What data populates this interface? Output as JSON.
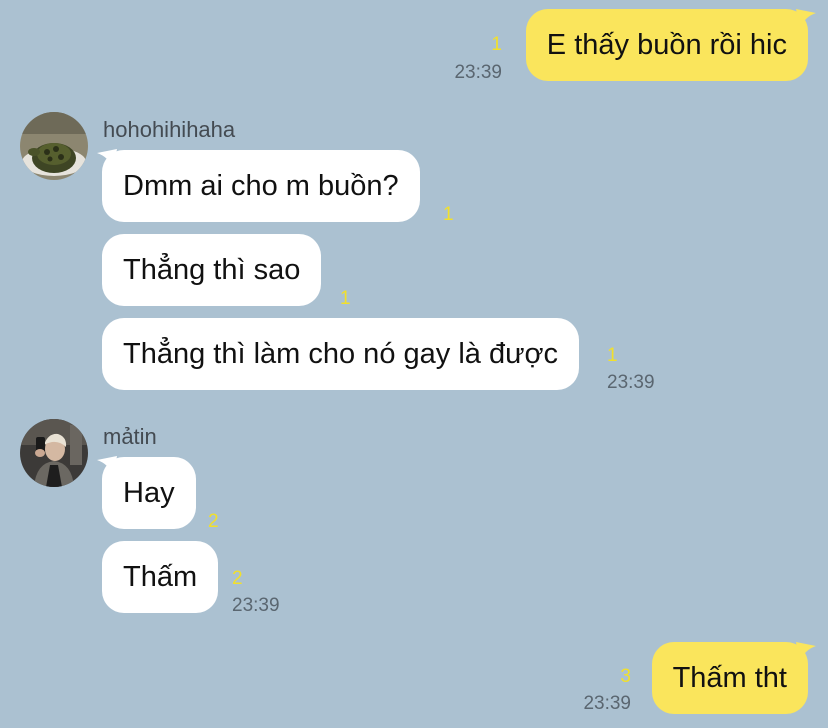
{
  "theme": {
    "background": "#abc1d1",
    "outgoing_bubble": "#fae55c",
    "incoming_bubble": "#ffffff",
    "read_count_color": "#f2e02b",
    "time_color": "#5a6670"
  },
  "messages": [
    {
      "direction": "out",
      "text": "E thấy buồn rồi hic",
      "unread": "1",
      "time": "23:39"
    },
    {
      "direction": "in",
      "sender": "hohohihihaha",
      "avatar_icon": "turtle-avatar-icon",
      "bubbles": [
        {
          "text": "Dmm ai cho m buồn?",
          "unread": "1"
        },
        {
          "text": "Thẳng thì sao",
          "unread": "1"
        },
        {
          "text": "Thẳng thì làm cho nó gay là được",
          "unread": "1",
          "time": "23:39"
        }
      ]
    },
    {
      "direction": "in",
      "sender": "mảtin",
      "avatar_icon": "person-selfie-avatar-icon",
      "bubbles": [
        {
          "text": "Hay",
          "unread": "2"
        },
        {
          "text": "Thấm",
          "unread": "2",
          "time": "23:39"
        }
      ]
    },
    {
      "direction": "out",
      "text": "Thấm tht",
      "unread": "3",
      "time": "23:39"
    }
  ]
}
